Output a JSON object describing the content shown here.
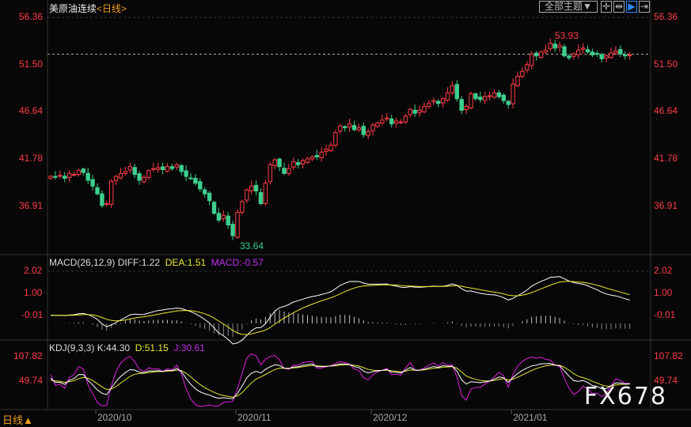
{
  "header": {
    "title": "美原油连续",
    "period": "<日线>",
    "theme_select": "全部主题▼",
    "tools": [
      {
        "icon": "crosshair-icon",
        "glyph": "✛"
      },
      {
        "icon": "range-icon",
        "glyph": "⇹"
      },
      {
        "icon": "play-icon",
        "glyph": "▶"
      },
      {
        "icon": "move-right-icon",
        "glyph": "⇥"
      }
    ]
  },
  "price_axis": [
    "56.36",
    "51.50",
    "46.64",
    "41.78",
    "36.91"
  ],
  "annotations": {
    "high": "53.93",
    "low": "33.64"
  },
  "macd": {
    "label": "MACD(26,12,9)",
    "diff": "DIFF:1.22",
    "dea": "DEA:1.51",
    "macd": "MACD:-0.57",
    "axis": [
      "2.02",
      "1.00",
      "-0.01"
    ]
  },
  "kdj": {
    "label": "KDJ(9,3,3)",
    "k": "K:44.30",
    "d": "D:51.15",
    "j": "J:30.61",
    "axis": [
      "107.82",
      "49.74"
    ]
  },
  "time_axis": [
    {
      "label": "2020/10",
      "index": 10
    },
    {
      "label": "2020/11",
      "index": 40
    },
    {
      "label": "2020/12",
      "index": 69
    },
    {
      "label": "2021/01",
      "index": 99
    }
  ],
  "period_button": "日线▲",
  "watermark": "FX678",
  "colors": {
    "up": "#ff3c46",
    "down": "#3ccf8e",
    "diff": "#ffffff",
    "dea": "#e8e830",
    "j": "#e020e0",
    "axis": "#ff3c46"
  },
  "chart_data": {
    "type": "candlestick",
    "closes": [
      40.0,
      39.9,
      40.1,
      39.8,
      40.3,
      40.2,
      40.6,
      40.4,
      39.6,
      39.0,
      38.2,
      37.0,
      37.2,
      39.5,
      40.0,
      40.3,
      40.5,
      41.0,
      40.2,
      39.6,
      39.9,
      40.6,
      40.8,
      40.9,
      40.7,
      41.0,
      40.8,
      41.2,
      40.5,
      40.0,
      39.8,
      39.3,
      38.7,
      38.2,
      37.5,
      36.2,
      35.5,
      36.0,
      35.0,
      33.9,
      36.3,
      37.4,
      38.6,
      39.0,
      38.5,
      37.2,
      39.3,
      41.2,
      41.7,
      41.0,
      40.3,
      40.8,
      41.5,
      41.2,
      41.6,
      41.8,
      42.0,
      42.0,
      42.5,
      42.8,
      43.2,
      44.5,
      45.2,
      45.0,
      45.4,
      44.8,
      45.0,
      44.3,
      44.6,
      45.3,
      45.5,
      45.8,
      46.0,
      45.4,
      45.7,
      45.6,
      46.2,
      46.9,
      46.5,
      46.8,
      47.2,
      47.5,
      47.8,
      47.5,
      48.0,
      48.6,
      49.3,
      48.0,
      46.8,
      47.2,
      48.5,
      48.0,
      47.9,
      48.2,
      48.3,
      48.6,
      48.2,
      47.8,
      47.4,
      49.5,
      50.3,
      50.8,
      51.5,
      52.6,
      52.4,
      52.8,
      53.0,
      53.7,
      53.2,
      53.5,
      52.4,
      52.2,
      52.6,
      53.0,
      53.2,
      52.8,
      52.5,
      52.6,
      52.1,
      52.4,
      52.7,
      52.9,
      52.6,
      52.4,
      52.5
    ],
    "price_range": [
      33.0,
      57.0
    ],
    "last_price": 52.5
  }
}
